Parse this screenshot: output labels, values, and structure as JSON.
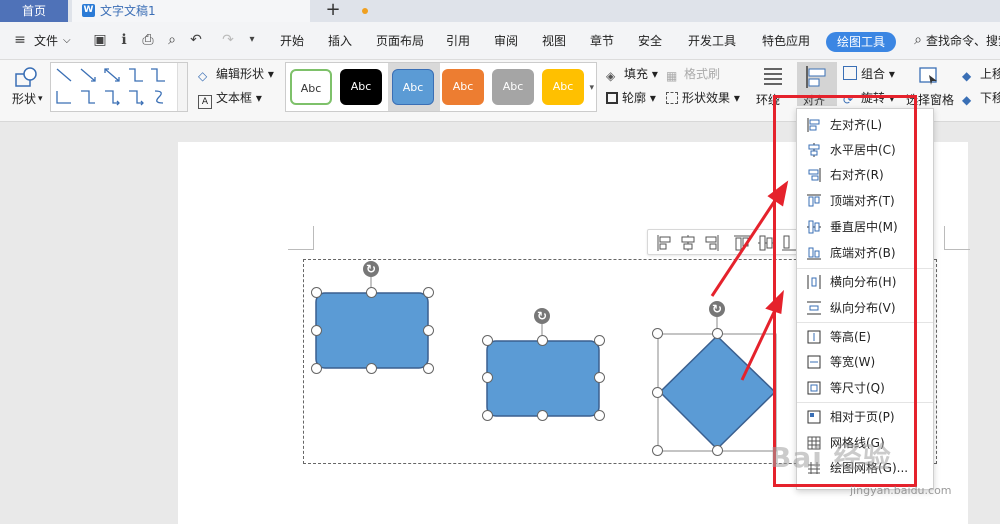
{
  "tabs": {
    "home": "首页",
    "doc_title": "文字文稿1",
    "doc_icon": "W",
    "new_tab": "+"
  },
  "menubar": {
    "file_label": "文件",
    "items": [
      "开始",
      "插入",
      "页面布局",
      "引用",
      "审阅",
      "视图",
      "章节",
      "安全",
      "开发工具",
      "特色应用"
    ],
    "active_tab": "绘图工具",
    "search": "查找命令、搜索"
  },
  "ribbon": {
    "shape_label": "形状",
    "edit_shape": "编辑形状",
    "text_box": "文本框",
    "style_samples": [
      "Abc",
      "Abc",
      "Abc",
      "Abc",
      "Abc",
      "Abc"
    ],
    "style_colors": {
      "outline": "#7ec16a",
      "black": "#000000",
      "blue": "#5b9bd5",
      "orange": "#ed7d31",
      "gray": "#a5a5a5",
      "gold": "#ffc000"
    },
    "fill": "填充",
    "format_painter": "格式刷",
    "outline": "轮廓",
    "shape_effects": "形状效果",
    "wrap": "环绕",
    "align": "对齐",
    "group": "组合",
    "rotate": "旋转",
    "selection_pane": "选择窗格",
    "move_up": "上移",
    "move_down": "下移"
  },
  "align_menu": {
    "items": [
      {
        "label": "左对齐(L)",
        "icon": "align-left-icon"
      },
      {
        "label": "水平居中(C)",
        "icon": "align-center-icon"
      },
      {
        "label": "右对齐(R)",
        "icon": "align-right-icon"
      },
      {
        "label": "顶端对齐(T)",
        "icon": "align-top-icon"
      },
      {
        "label": "垂直居中(M)",
        "icon": "align-middle-icon"
      },
      {
        "label": "底端对齐(B)",
        "icon": "align-bottom-icon"
      },
      {
        "label": "横向分布(H)",
        "icon": "distribute-horizontal-icon"
      },
      {
        "label": "纵向分布(V)",
        "icon": "distribute-vertical-icon"
      },
      {
        "label": "等高(E)",
        "icon": "same-height-icon"
      },
      {
        "label": "等宽(W)",
        "icon": "same-width-icon"
      },
      {
        "label": "等尺寸(Q)",
        "icon": "same-size-icon"
      },
      {
        "label": "相对于页(P)",
        "icon": "relative-to-page-icon"
      },
      {
        "label": "网格线(G)",
        "icon": "gridlines-icon"
      },
      {
        "label": "绘图网格(G)...",
        "icon": "drawing-grid-icon"
      }
    ]
  },
  "colors": {
    "shape_fill": "#5b9bd5",
    "shape_stroke": "#3a5f8f",
    "highlight_red": "#e5222c",
    "accent_blue": "#3b86e3"
  },
  "watermark": {
    "text": "Bai 经验",
    "url": "jingyan.baidu.com"
  }
}
